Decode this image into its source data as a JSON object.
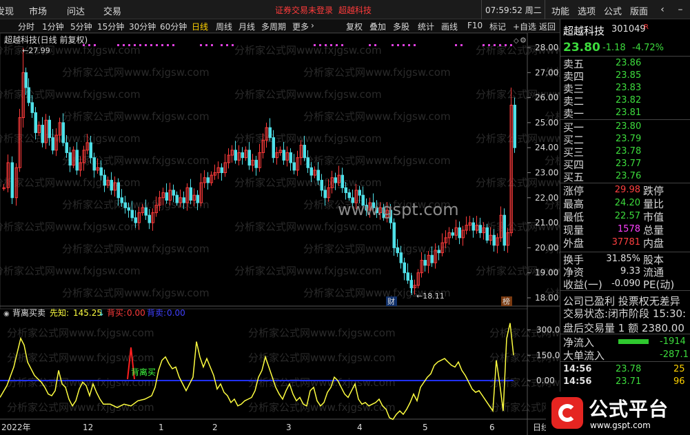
{
  "menu": {
    "items": [
      "发现",
      "市场",
      "问达",
      "交易"
    ],
    "notice": "证券交易未登录",
    "stock_link": "超越科技",
    "clock": "07:59:52 周二",
    "right_items": [
      "功能",
      "选项",
      "公式",
      "版面"
    ]
  },
  "toolbar": {
    "periods": [
      "分时",
      "1分钟",
      "5分钟",
      "15分钟",
      "30分钟",
      "60分钟",
      "日线",
      "周线",
      "月线",
      "多周期",
      "更多"
    ],
    "active": "日线",
    "tools": [
      "复权",
      "叠加",
      "多股",
      "统计",
      "画线",
      "F10",
      "标记",
      "+自选",
      "返回"
    ]
  },
  "chart": {
    "title": "超越科技(日线 前复权)",
    "high_label": "27.99",
    "low_label": "18.11",
    "price_ticks": [
      "28.00",
      "27.00",
      "26.00",
      "25.00",
      "24.00",
      "23.00",
      "22.00",
      "21.00",
      "20.00",
      "19.00",
      "18.00"
    ],
    "marker_cai": "财",
    "marker_bang": "榜",
    "watermark": "www.gspt.com",
    "bg_watermark": "分析家公式网www.fxjgsw.com",
    "up_color": "#ff3b3b",
    "down_color": "#4fe0e8"
  },
  "indicator": {
    "name": "背离买卖",
    "xianzhi_label": "先知:",
    "xianzhi_value": "145.25",
    "beimai_label": "背买:",
    "beimai_value": "0.00",
    "beimai2_label": "背卖:",
    "beimai2_value": "0.00",
    "signal_text": "背离买",
    "ticks": [
      "300.0",
      "150.0",
      "0.00"
    ]
  },
  "x_axis": {
    "labels": [
      "2022年",
      "12",
      "1",
      "2",
      "3",
      "4",
      "5",
      "6"
    ],
    "right_label": "日线"
  },
  "quote": {
    "name": "超越科技",
    "code": "301049",
    "r_badge": "R",
    "price": "23.80",
    "change": "-1.18",
    "pct": "-4.72%",
    "asks": [
      {
        "label": "卖五",
        "price": "23.86"
      },
      {
        "label": "卖四",
        "price": "23.85"
      },
      {
        "label": "卖三",
        "price": "23.83"
      },
      {
        "label": "卖二",
        "price": "23.82"
      },
      {
        "label": "卖一",
        "price": "23.81"
      }
    ],
    "bids": [
      {
        "label": "买一",
        "price": "23.80"
      },
      {
        "label": "买二",
        "price": "23.79"
      },
      {
        "label": "买三",
        "price": "23.78"
      },
      {
        "label": "买四",
        "price": "23.77"
      },
      {
        "label": "买五",
        "price": "23.76"
      }
    ],
    "stats": [
      {
        "label": "涨停",
        "value": "29.98",
        "label2": "跌停",
        "color": "red"
      },
      {
        "label": "最高",
        "value": "24.20",
        "label2": "量比",
        "color": "green"
      },
      {
        "label": "最低",
        "value": "22.57",
        "label2": "市值",
        "color": "green"
      },
      {
        "label": "现量",
        "value": "1578",
        "label2": "总量",
        "color": "magenta"
      },
      {
        "label": "外盘",
        "value": "37781",
        "label2": "内盘",
        "color": "red"
      }
    ],
    "stats2": [
      {
        "label": "换手",
        "value": "31.85%",
        "label2": "股本"
      },
      {
        "label": "净资",
        "value": "9.33",
        "label2": "流通"
      },
      {
        "label": "收益(一)",
        "value": "-0.090",
        "label2": "PE(动)"
      }
    ],
    "profit_line": "公司已盈利 投票权无差异",
    "trade_state": "交易状态:闭市阶段 15:30:",
    "after_hours": "盘后交易量 1 额 2380.00",
    "net_in_label": "净流入",
    "net_in_value": "-1914",
    "big_in_label": "大单流入",
    "big_in_value": "-287.1",
    "ticks": [
      {
        "time": "14:56",
        "price": "23.78",
        "vol": "25"
      },
      {
        "time": "14:56",
        "price": "23.71",
        "vol": "96"
      }
    ]
  },
  "logo": {
    "title": "公式平台",
    "url": "www.gspt.com"
  }
}
